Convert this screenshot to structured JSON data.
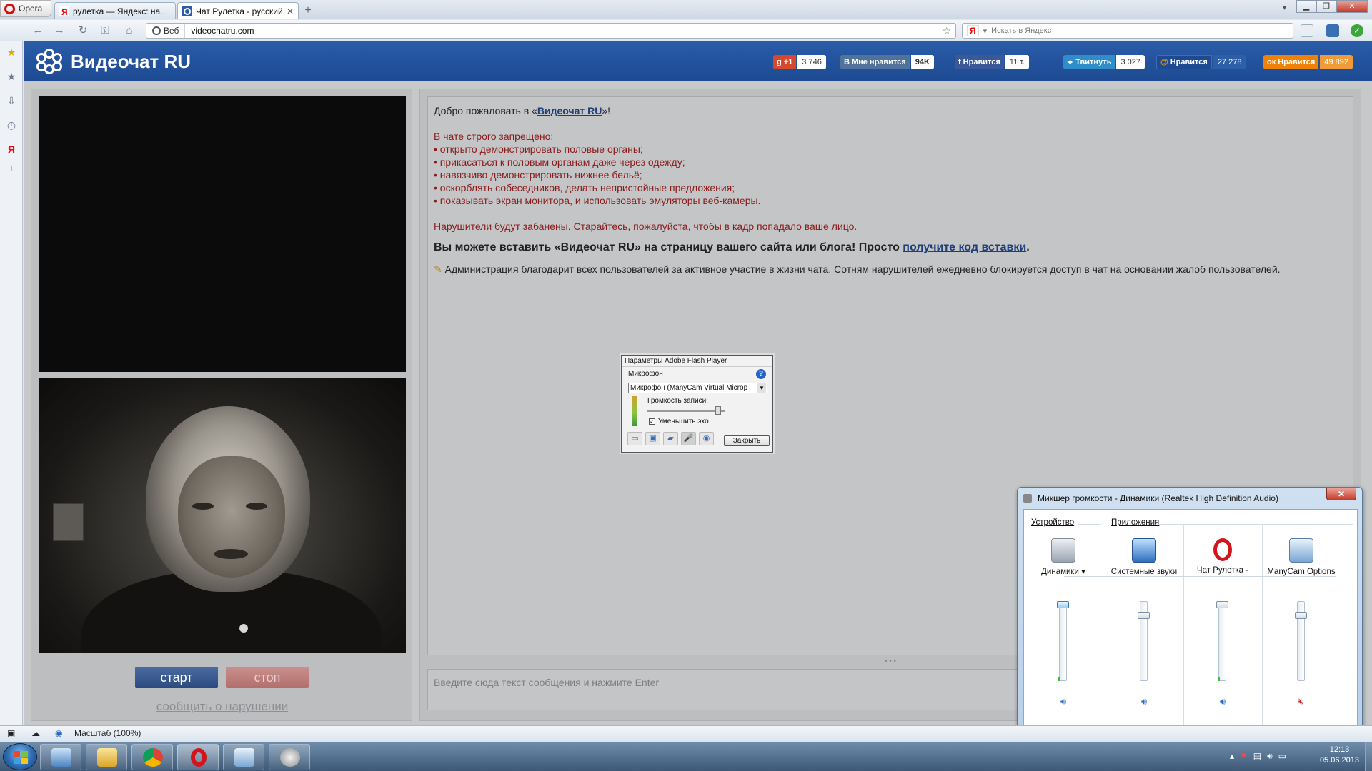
{
  "browser": {
    "menu_label": "Opera",
    "tabs": [
      {
        "label": "рулетка — Яндекс: на...",
        "active": false
      },
      {
        "label": "Чат Рулетка - русский...",
        "active": true
      }
    ],
    "address": {
      "mode_label": "Веб",
      "url": "videochatru.com"
    },
    "search": {
      "placeholder": "Искать в Яндекс"
    },
    "status": {
      "zoom": "Масштаб (100%)"
    }
  },
  "site": {
    "logo": "Видеочат RU",
    "social": [
      {
        "label": "+1",
        "count": "3 746",
        "color": "#d6492e"
      },
      {
        "label": "Мне нравится",
        "count": "94K",
        "color": "#50729b"
      },
      {
        "label": "Нравится",
        "count": "11 т.",
        "color": "#3b5998"
      },
      {
        "label": "Твитнуть",
        "count": "3 027",
        "color": "#2f8dc9"
      },
      {
        "label": "Нравится",
        "count": "27 278",
        "color": "#1d4a92"
      },
      {
        "label": "Нравится",
        "count": "49 892",
        "color": "#ee8208"
      }
    ],
    "controls": {
      "start": "старт",
      "stop": "стоп",
      "report": "сообщить о нарушении"
    },
    "chat": {
      "welcome_pre": "Добро пожаловать в «",
      "welcome_link": "Видеочат RU",
      "welcome_post": "»!",
      "rules_title": "В чате строго запрещено:",
      "rules": [
        "• открыто демонстрировать половые органы;",
        "• прикасаться к половым органам даже через одежду;",
        "• навязчиво демонстрировать нижнее бельё;",
        "• оскорблять собеседников, делать непристойные предложения;",
        "• показывать экран монитора, и использовать эмуляторы веб-камеры."
      ],
      "warning": "Нарушители будут забанены. Старайтесь, пожалуйста, чтобы в кадр попадало ваше лицо.",
      "embed_pre": "Вы можете вставить «Видеочат RU» на страницу вашего сайта или блога! Просто ",
      "embed_link": "получите код вставки",
      "embed_post": ".",
      "admin_note": "Администрация благодарит всех пользователей за активное участие в жизни чата. Сотням нарушителей ежедневно блокируется доступ в чат на основании жалоб пользователей.",
      "input_placeholder": "Введите сюда текст сообщения и нажмите Enter"
    }
  },
  "flash_dialog": {
    "title": "Параметры Adobe Flash Player",
    "section": "Микрофон",
    "device": "Микрофон (ManyCam Virtual Microp",
    "volume_label": "Громкость записи:",
    "volume_level": 0.92,
    "echo_label": "Уменьшить эхо",
    "echo_checked": true,
    "close": "Закрыть"
  },
  "mixer": {
    "title": "Микшер громкости - Динамики (Realtek High Definition Audio)",
    "device_group": "Устройство",
    "apps_group": "Приложения",
    "channels": [
      {
        "name": "Динамики",
        "level": 1.0,
        "muted": false,
        "icon": "speaker-icon"
      },
      {
        "name": "Системные звуки",
        "level": 0.85,
        "muted": false,
        "icon": "system-sounds-icon"
      },
      {
        "name": "Чат Рулетка -",
        "level": 1.0,
        "muted": false,
        "icon": "opera-icon"
      },
      {
        "name": "ManyCam Options",
        "level": 0.85,
        "muted": true,
        "icon": "manycam-icon"
      }
    ]
  },
  "taskbar": {
    "time": "12:13",
    "date": "05.06.2013"
  }
}
